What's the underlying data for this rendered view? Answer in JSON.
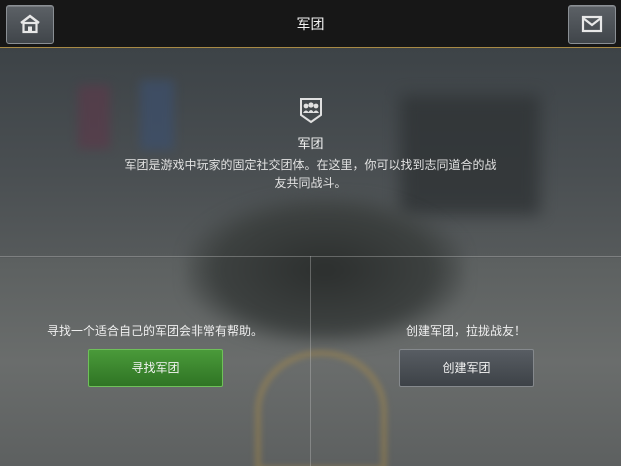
{
  "header": {
    "title": "军团",
    "home_icon": "home-icon",
    "mail_icon": "mail-icon"
  },
  "intro": {
    "emblem_icon": "legion-emblem-icon",
    "heading": "军团",
    "description": "军团是游戏中玩家的固定社交团体。在这里，你可以找到志同道合的战友共同战斗。"
  },
  "find_panel": {
    "text": "寻找一个适合自己的军团会非常有帮助。",
    "button_label": "寻找军团",
    "button_color": "#3d8a30"
  },
  "create_panel": {
    "text": "创建军团，拉拢战友！",
    "button_label": "创建军团",
    "button_color": "#4a4f55"
  },
  "colors": {
    "accent_line": "#a88a45"
  }
}
